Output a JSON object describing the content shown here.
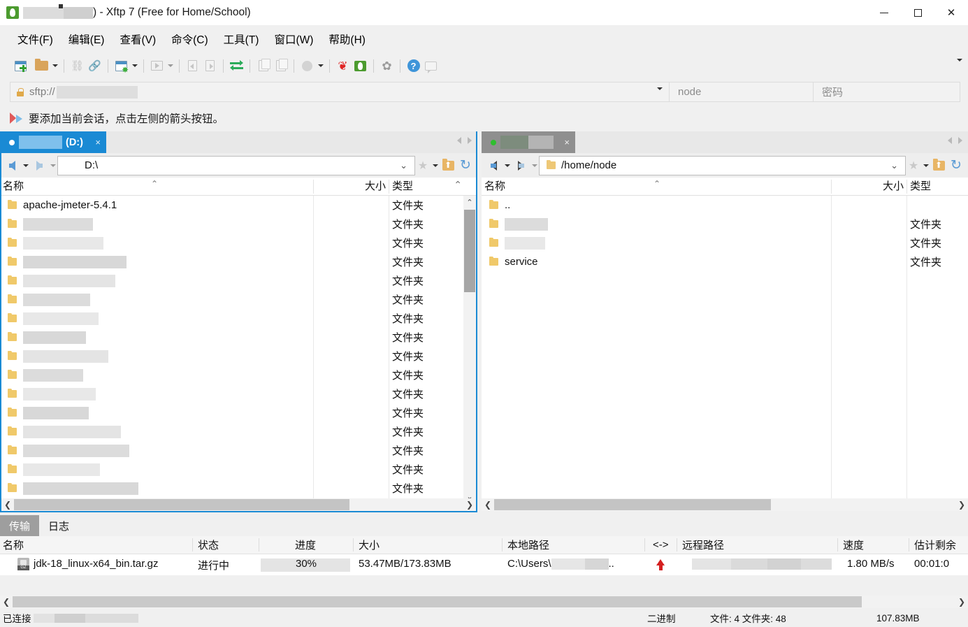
{
  "window": {
    "title_suffix": ") - Xftp 7 (Free for Home/School)",
    "app_icon": "xftp-logo-icon",
    "controls": {
      "minimize": "minimize-icon",
      "maximize": "maximize-icon",
      "close": "close-icon"
    }
  },
  "menubar": {
    "items": [
      {
        "label": "文件(F)",
        "name": "menu-file"
      },
      {
        "label": "编辑(E)",
        "name": "menu-edit"
      },
      {
        "label": "查看(V)",
        "name": "menu-view"
      },
      {
        "label": "命令(C)",
        "name": "menu-command"
      },
      {
        "label": "工具(T)",
        "name": "menu-tools"
      },
      {
        "label": "窗口(W)",
        "name": "menu-window"
      },
      {
        "label": "帮助(H)",
        "name": "menu-help"
      }
    ]
  },
  "toolbar": {
    "icons": [
      "new-session-icon",
      "open-folder-icon",
      "disconnect-icon",
      "connect-icon",
      "session-properties-icon",
      "run-icon",
      "download-icon",
      "upload-icon",
      "sync-transfer-icon",
      "copy-icon",
      "paste-icon",
      "transfer-mode-icon",
      "xshell-icon",
      "xftp-icon",
      "options-gear-icon",
      "help-icon",
      "feedback-icon"
    ],
    "overflow": "toolbar-overflow-chevron"
  },
  "addressbar": {
    "protocol": "sftp://",
    "host_redacted": true,
    "lock_icon": "lock-icon",
    "dropdown_icon": "chevron-down-icon",
    "user_placeholder": "node",
    "password_placeholder": "密码"
  },
  "hint": {
    "icon": "flag-icon",
    "text": "要添加当前会话，点击左侧的箭头按钮。"
  },
  "left_panel": {
    "tab": {
      "label": "(D:)",
      "status_dot": "white",
      "close": "×"
    },
    "path": "D:\\",
    "columns": {
      "name": "名称",
      "size": "大小",
      "type": "类型"
    },
    "rows": [
      {
        "name": "apache-jmeter-5.4.1",
        "redacted": false,
        "size": "",
        "type": "文件夹"
      },
      {
        "name": "",
        "redacted": true,
        "redact_w": 100,
        "size": "",
        "type": "文件夹"
      },
      {
        "name": "",
        "redacted": true,
        "redact_w": 115,
        "size": "",
        "type": "文件夹"
      },
      {
        "name": "",
        "redacted": true,
        "redact_w": 148,
        "size": "",
        "type": "文件夹"
      },
      {
        "name": "",
        "redacted": true,
        "redact_w": 132,
        "size": "",
        "type": "文件夹"
      },
      {
        "name": "",
        "redacted": true,
        "redact_w": 96,
        "size": "",
        "type": "文件夹"
      },
      {
        "name": "",
        "redacted": true,
        "redact_w": 108,
        "size": "",
        "type": "文件夹"
      },
      {
        "name": "",
        "redacted": true,
        "redact_w": 90,
        "size": "",
        "type": "文件夹"
      },
      {
        "name": "",
        "redacted": true,
        "redact_w": 122,
        "size": "",
        "type": "文件夹"
      },
      {
        "name": "",
        "redacted": true,
        "redact_w": 86,
        "size": "",
        "type": "文件夹"
      },
      {
        "name": "",
        "redacted": true,
        "redact_w": 104,
        "size": "",
        "type": "文件夹"
      },
      {
        "name": "",
        "redacted": true,
        "redact_w": 94,
        "size": "",
        "type": "文件夹"
      },
      {
        "name": "",
        "redacted": true,
        "redact_w": 140,
        "size": "",
        "type": "文件夹"
      },
      {
        "name": "",
        "redacted": true,
        "redact_w": 152,
        "size": "",
        "type": "文件夹"
      },
      {
        "name": "",
        "redacted": true,
        "redact_w": 110,
        "size": "",
        "type": "文件夹"
      },
      {
        "name": "",
        "redacted": true,
        "redact_w": 165,
        "size": "",
        "type": "文件夹"
      },
      {
        "name": "",
        "redacted": true,
        "redact_w": 130,
        "size": "",
        "type": "文件夹"
      }
    ]
  },
  "right_panel": {
    "tab": {
      "label": "",
      "redacted": true,
      "status_dot": "green",
      "close": "×"
    },
    "path": "/home/node",
    "columns": {
      "name": "名称",
      "size": "大小",
      "type": "类型"
    },
    "rows": [
      {
        "name": "..",
        "redacted": false,
        "size": "",
        "type": ""
      },
      {
        "name": "",
        "redacted": true,
        "redact_w": 62,
        "size": "",
        "type": "文件夹"
      },
      {
        "name": "",
        "redacted": true,
        "redact_w": 58,
        "size": "",
        "type": "文件夹"
      },
      {
        "name": "service",
        "redacted": false,
        "size": "",
        "type": "文件夹"
      }
    ]
  },
  "transfer_pane": {
    "tabs": [
      {
        "label": "传输",
        "active": true
      },
      {
        "label": "日志",
        "active": false
      }
    ],
    "columns": {
      "name": "名称",
      "status": "状态",
      "progress": "进度",
      "size": "大小",
      "local_path": "本地路径",
      "direction": "<->",
      "remote_path": "远程路径",
      "speed": "速度",
      "eta": "估计剩余"
    },
    "rows": [
      {
        "name": "jdk-18_linux-x64_bin.tar.gz",
        "status": "进行中",
        "progress_pct": 30,
        "progress_label": "30%",
        "size": "53.47MB/173.83MB",
        "local_path_prefix": "C:\\Users\\",
        "local_path_redacted": true,
        "local_path_suffix": "..",
        "direction_icon": "upload-arrow-icon",
        "remote_path_redacted": true,
        "speed": "1.80 MB/s",
        "eta": "00:01:0"
      }
    ]
  },
  "statusbar": {
    "connection": "已连接",
    "connection_redacted": true,
    "mode": "二进制",
    "counts": "文件: 4 文件夹: 48",
    "total_size": "107.83MB"
  },
  "colors": {
    "accent_blue": "#1a8ad4",
    "progress_blue": "#0b84d9",
    "tab_gray": "#8f8f8f",
    "folder_yellow": "#f0c96a"
  }
}
